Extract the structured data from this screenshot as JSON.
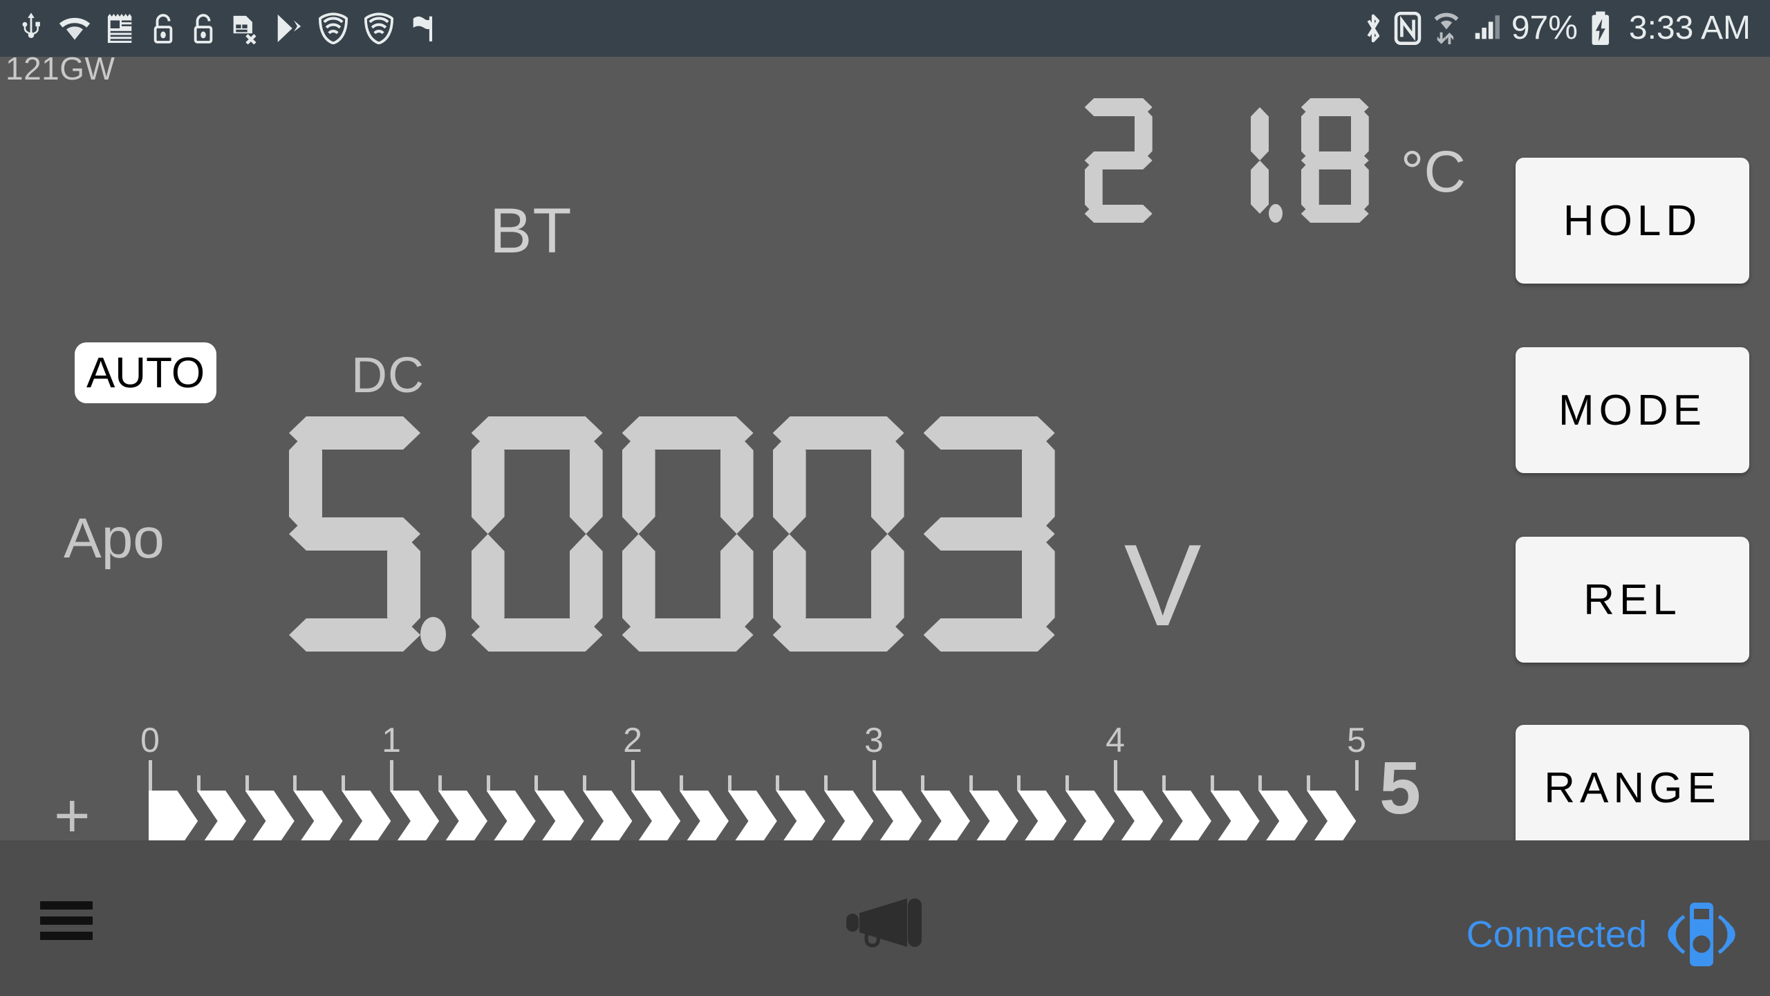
{
  "statusbar": {
    "left_icons": [
      "usb-icon",
      "wifi-icon",
      "notes-icon",
      "lock-open-icon",
      "lock-open-icon-2",
      "sim-card-x-icon",
      "play-store-icon",
      "vpn-shield-icon",
      "vpn-shield-icon-2",
      "flag-icon"
    ],
    "right_icons": [
      "bluetooth-icon",
      "nfc-icon",
      "wifi-data-icon",
      "cell-signal-icon",
      "battery-charging-icon"
    ],
    "battery_percent": "97%",
    "time": "3:33 AM"
  },
  "panel": {
    "model": "121GW",
    "bt_label": "BT",
    "dc_label": "DC",
    "apo_label": "Apo",
    "auto_label": "AUTO",
    "temperature": {
      "digits": "21.8",
      "unit": "°C"
    },
    "reading": {
      "digits": "5.0003",
      "unit": "V"
    }
  },
  "bargraph": {
    "polarity": "+",
    "tick_labels": [
      "0",
      "1",
      "2",
      "3",
      "4",
      "5"
    ],
    "range_label": "5",
    "min": 0,
    "max": 5,
    "value": 5.0003,
    "segments_total": 25,
    "segments_filled": 25,
    "minor_per_major": 5
  },
  "buttons": [
    {
      "name": "hold-button",
      "label": "HOLD"
    },
    {
      "name": "mode-button",
      "label": "MODE"
    },
    {
      "name": "rel-button",
      "label": "REL"
    },
    {
      "name": "range-button",
      "label": "RANGE"
    }
  ],
  "bottombar": {
    "menu_icon": "hamburger-menu-icon",
    "announce_icon": "megaphone-icon",
    "connection_status": "Connected",
    "device_icon": "multimeter-signal-icon"
  },
  "colors": {
    "status_bar_bg": "#37424b",
    "panel_bg": "#595959",
    "bottom_bar_bg": "#4d4d4d",
    "lcd_segment": "#cdcdcd",
    "bargraph_fill": "#ffffff",
    "button_bg": "#f5f5f5",
    "connected_blue": "#3d93f0"
  }
}
